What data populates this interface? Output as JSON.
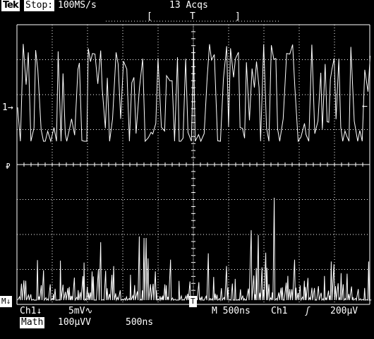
{
  "header": {
    "brand": "Tek",
    "state": "Stop:",
    "sample_rate": "100MS/s",
    "acquisitions": "13 Acqs",
    "trigger_bracket_left": "[",
    "trigger_marker": "T",
    "trigger_bracket_right": "]"
  },
  "markers": {
    "ch1_ground": "1→",
    "ch1_trigger_level": "←",
    "math_label": "M↓",
    "reference_glyph": "₽",
    "math_trigger_glyph": "T"
  },
  "footer": {
    "ch1_label": "Ch1↓",
    "ch1_scale": "5mV∿",
    "timebase": "M 500ns",
    "trigger_source": "Ch1",
    "trigger_slope": "ʃ",
    "trigger_level": "200μV",
    "math_label": "Math",
    "math_scale": "100μVV",
    "math_timebase": "500ns"
  },
  "colors": {
    "background": "#000000",
    "trace": "#ffffff",
    "graticule": "#ffffff"
  }
}
